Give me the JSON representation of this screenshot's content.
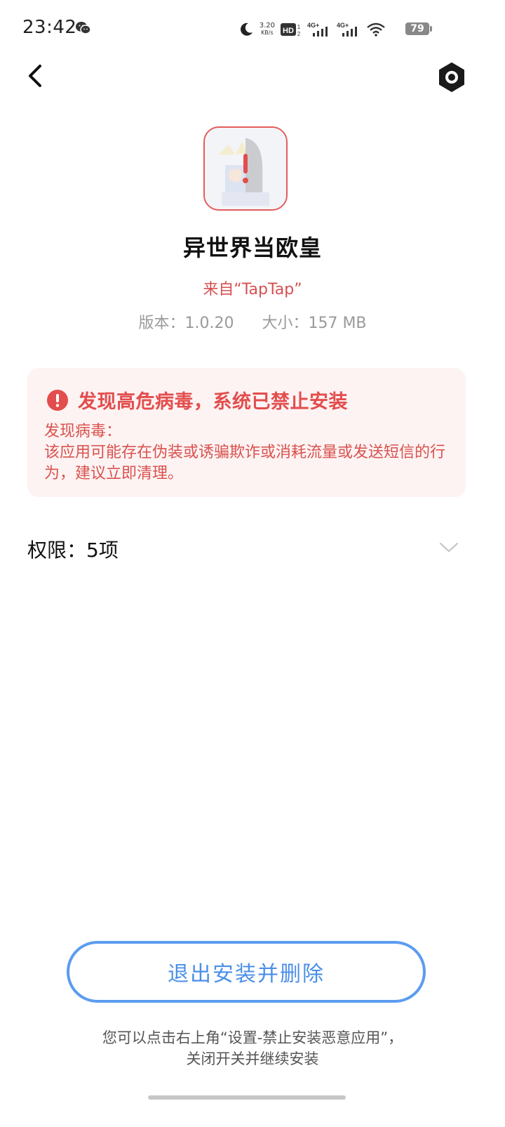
{
  "status_bar": {
    "time": "23:42",
    "net_speed_value": "3.20",
    "net_speed_unit": "KB/s",
    "hd_label": "HD",
    "signal_1": "4G+",
    "signal_2": "4G+",
    "battery": "79",
    "icons": [
      "wechat-icon",
      "moon-icon",
      "hd-icon",
      "signal-icon",
      "signal-icon",
      "wifi-icon",
      "battery-icon"
    ]
  },
  "nav": {
    "back_icon": "chevron-left-icon",
    "settings_icon": "settings-icon"
  },
  "app": {
    "name": "异世界当欧皇",
    "source": "来自“TapTap”",
    "version": "版本：1.0.20",
    "size": "大小：157 MB"
  },
  "warning": {
    "title": "发现高危病毒，系统已禁止安装",
    "subtitle": "发现病毒：",
    "description": "该应用可能存在伪装或诱骗欺诈或消耗流量或发送短信的行为，建议立即清理。"
  },
  "permissions": {
    "label": "权限：5项"
  },
  "actions": {
    "exit_delete_label": "退出安装并删除",
    "hint_line1": "您可以点击右上角“设置-禁止安装恶意应用”，",
    "hint_line2": "关闭开关并继续安装"
  },
  "colors": {
    "danger": "#e34d4d",
    "danger_bg": "#fdf3f3",
    "accent": "#4b8fe8",
    "muted": "#9a9a9a"
  }
}
